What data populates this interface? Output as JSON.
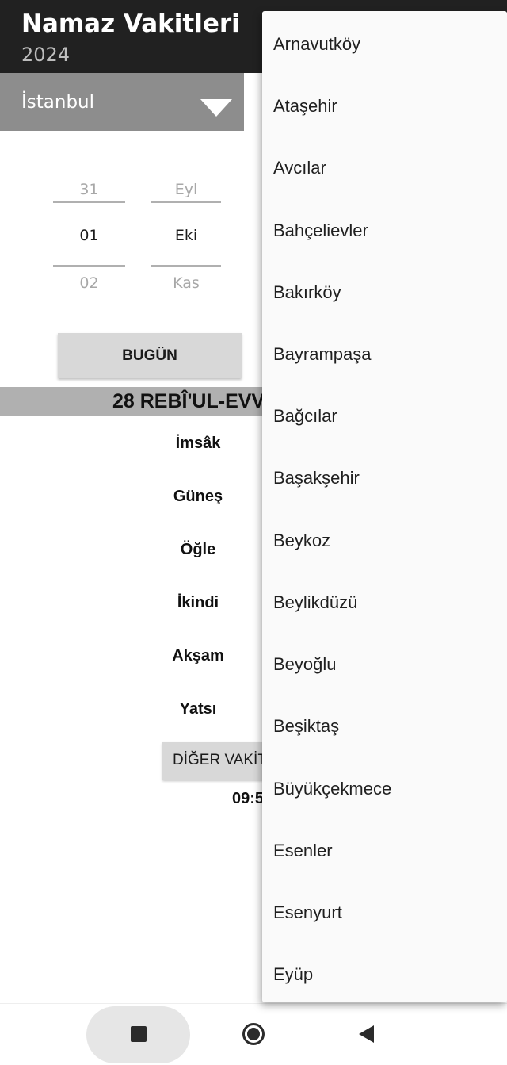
{
  "app": {
    "title": "Namaz Vakitleri",
    "subtitle": "2024"
  },
  "city_spinner": {
    "selected": "İstanbul"
  },
  "date_picker": {
    "day": {
      "prev": "31",
      "current": "01",
      "next": "02"
    },
    "month": {
      "prev": "Eyl",
      "current": "Eki",
      "next": "Kas"
    }
  },
  "today_button": "BUGÜN",
  "hijri_date": "28  REBÎ'UL-EVV",
  "prayers": [
    "İmsâk",
    "Güneş",
    "Öğle",
    "İkindi",
    "Akşam",
    "Yatsı"
  ],
  "other_times_button": "DİĞER VAKİT",
  "time_partial": "09:5",
  "dropdown": {
    "items": [
      "Arnavutköy",
      "Ataşehir",
      "Avcılar",
      "Bahçelievler",
      "Bakırköy",
      "Bayrampaşa",
      "Bağcılar",
      "Başakşehir",
      "Beykoz",
      "Beylikdüzü",
      "Beyoğlu",
      "Beşiktaş",
      "Büyükçekmece",
      "Esenler",
      "Esenyurt",
      "Eyüp"
    ]
  },
  "nav": {
    "icons": [
      "recents-square-icon",
      "home-circle-icon",
      "back-triangle-icon"
    ]
  }
}
